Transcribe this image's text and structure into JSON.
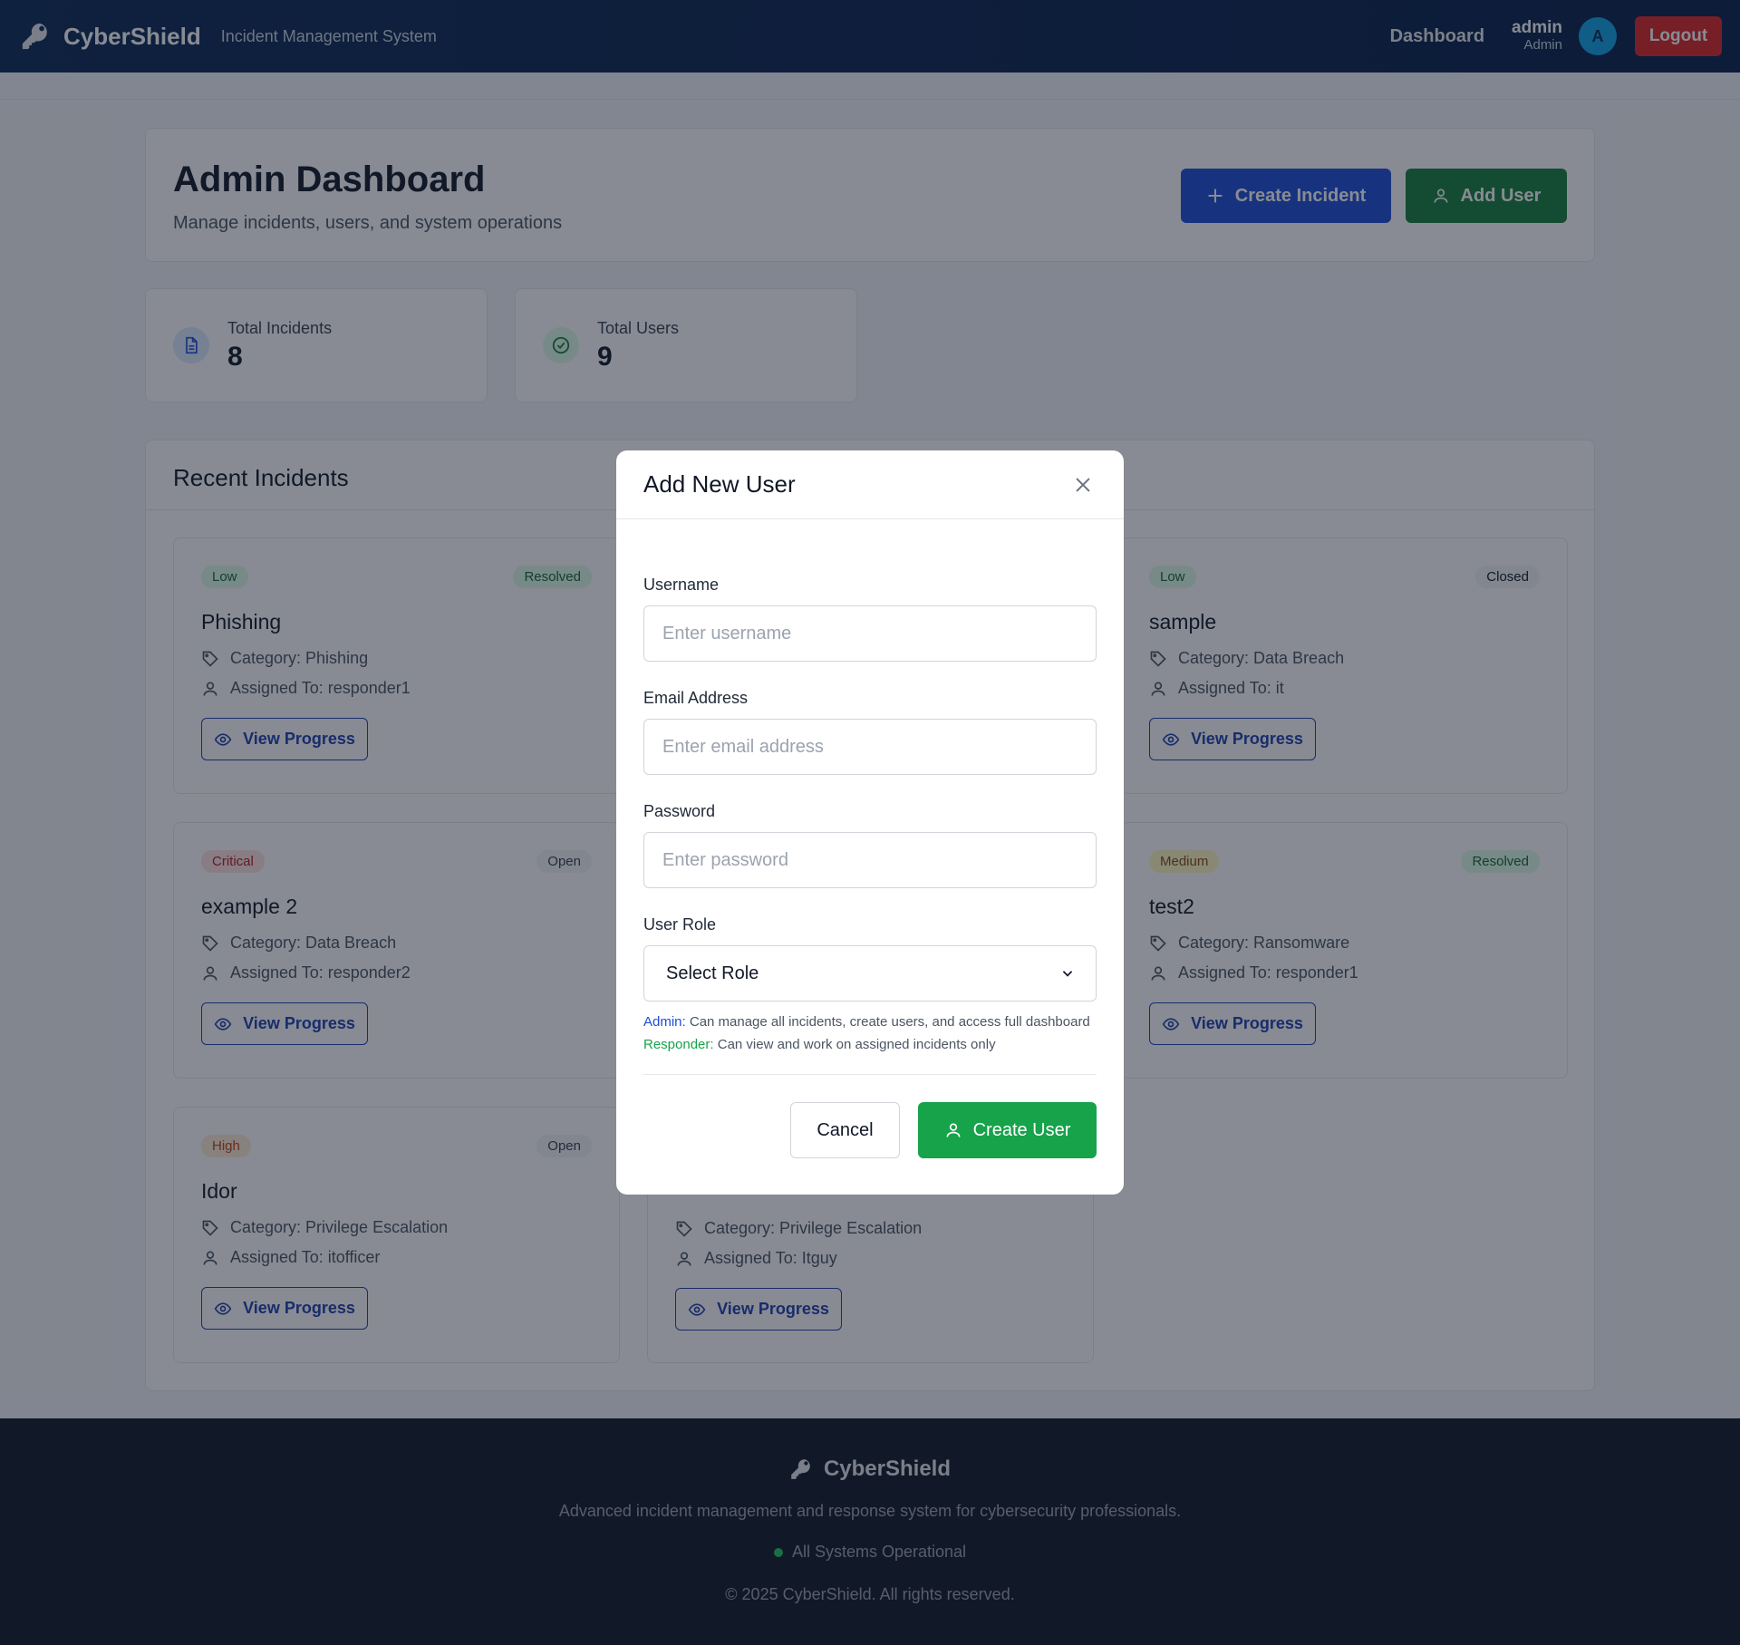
{
  "navbar": {
    "brand": "CyberShield",
    "subtitle": "Incident Management System",
    "dashboard_link": "Dashboard",
    "username": "admin",
    "user_role": "Admin",
    "avatar_initial": "A",
    "logout_label": "Logout"
  },
  "header": {
    "title": "Admin Dashboard",
    "subtitle": "Manage incidents, users, and system operations",
    "create_incident_label": "Create Incident",
    "add_user_label": "Add User"
  },
  "stats": [
    {
      "label": "Total Incidents",
      "value": "8"
    },
    {
      "label": "Total Users",
      "value": "9"
    }
  ],
  "recent": {
    "title": "Recent Incidents",
    "view_label": "View Progress",
    "incidents": [
      {
        "severity": "Low",
        "status": "Resolved",
        "title": "Phishing",
        "category": "Category: Phishing",
        "assigned": "Assigned To: responder1"
      },
      {
        "severity": "Low",
        "status": "Closed",
        "title": "sample",
        "category": "Category: Data Breach",
        "assigned": "Assigned To: it"
      },
      {
        "severity": "Critical",
        "status": "Open",
        "title": "example 2",
        "category": "Category: Data Breach",
        "assigned": "Assigned To: responder2"
      },
      {
        "severity": "Medium",
        "status": "Resolved",
        "title": "test2",
        "category": "Category: Ransomware",
        "assigned": "Assigned To: responder1"
      },
      {
        "severity": "High",
        "status": "Open",
        "title": "Idor",
        "category": "Category: Privilege Escalation",
        "assigned": "Assigned To: itofficer"
      },
      {
        "category": "Category: Privilege Escalation",
        "assigned": "Assigned To: Itguy"
      }
    ]
  },
  "footer": {
    "brand": "CyberShield",
    "description": "Advanced incident management and response system for cybersecurity professionals.",
    "status": "All Systems Operational",
    "copyright": "© 2025 CyberShield. All rights reserved."
  },
  "modal": {
    "title": "Add New User",
    "username_label": "Username",
    "username_placeholder": "Enter username",
    "email_label": "Email Address",
    "email_placeholder": "Enter email address",
    "password_label": "Password",
    "password_placeholder": "Enter password",
    "role_label": "User Role",
    "role_selected": "Select Role",
    "admin_help_label": "Admin:",
    "admin_help_text": " Can manage all incidents, create users, and access full dashboard",
    "responder_help_label": "Responder:",
    "responder_help_text": " Can view and work on assigned incidents only",
    "cancel_label": "Cancel",
    "create_label": "Create User"
  },
  "colors": {
    "navbar": "#0b2a55",
    "primary_blue": "#1d4ed8",
    "success_green": "#16a34a",
    "danger_red": "#dc2626",
    "footer_bg": "#111827"
  }
}
